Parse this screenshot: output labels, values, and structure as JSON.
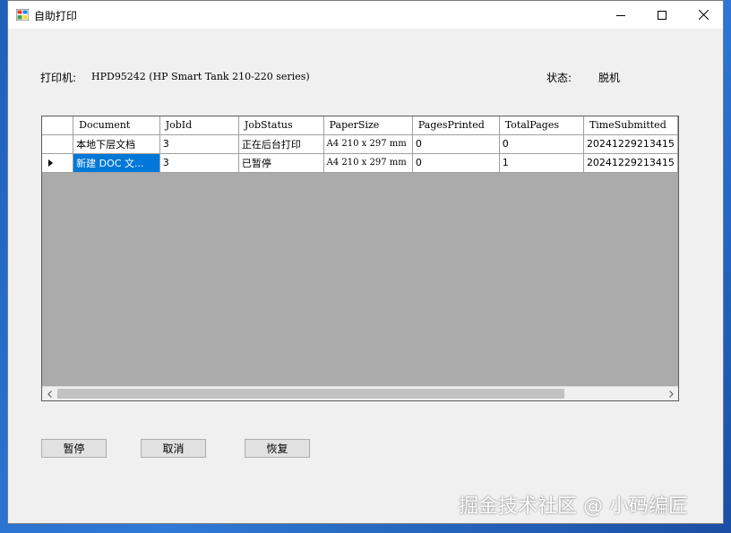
{
  "window": {
    "title": "自助打印",
    "icons": [
      "printer-app-icon",
      "minimize-icon",
      "maximize-icon",
      "close-icon"
    ]
  },
  "printer": {
    "label": "打印机:",
    "name": "HPD95242 (HP Smart Tank 210-220 series)"
  },
  "status": {
    "label": "状态:",
    "value": "脱机"
  },
  "grid": {
    "columns": [
      "Document",
      "JobId",
      "JobStatus",
      "PaperSize",
      "PagesPrinted",
      "TotalPages",
      "TimeSubmitted"
    ],
    "rows": [
      {
        "document": "本地下层文档",
        "jobid": "3",
        "jobstatus": "正在后台打印",
        "papersize": "A4 210 x 297 mm",
        "pagesprinted": "0",
        "totalpages": "0",
        "timesubmitted": "20241229213415"
      },
      {
        "document": "新建 DOC 文...",
        "jobid": "3",
        "jobstatus": "已暂停",
        "papersize": "A4 210 x 297 mm",
        "pagesprinted": "0",
        "totalpages": "1",
        "timesubmitted": "20241229213415"
      }
    ],
    "selected_color": "#0078d7",
    "empty_area_color": "#ababab"
  },
  "buttons": {
    "pause": "暂停",
    "cancel": "取消",
    "resume": "恢复"
  },
  "watermark": "掘金技术社区 @ 小码编匠"
}
